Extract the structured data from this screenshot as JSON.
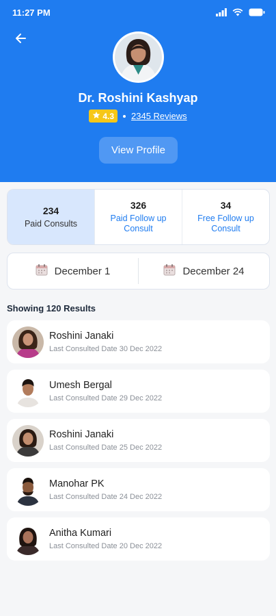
{
  "status_bar": {
    "time": "11:27 PM"
  },
  "doctor": {
    "name": "Dr. Roshini Kashyap",
    "rating": "4.3",
    "reviews": "2345 Reviews",
    "view_profile_label": "View Profile"
  },
  "tabs": [
    {
      "count": "234",
      "label": "Paid Consults",
      "active": true
    },
    {
      "count": "326",
      "label": "Paid Follow up Consult",
      "active": false
    },
    {
      "count": "34",
      "label": "Free Follow up Consult",
      "active": false
    }
  ],
  "date_range": {
    "from": "December 1",
    "to": "December 24"
  },
  "results": {
    "title": "Showing 120 Results",
    "items": [
      {
        "name": "Roshini Janaki",
        "date": "Last Consulted Date 30 Dec 2022"
      },
      {
        "name": "Umesh Bergal",
        "date": "Last Consulted Date 29 Dec 2022"
      },
      {
        "name": "Roshini Janaki",
        "date": "Last Consulted Date 25 Dec 2022"
      },
      {
        "name": "Manohar PK",
        "date": "Last Consulted Date 24 Dec 2022"
      },
      {
        "name": "Anitha Kumari",
        "date": "Last Consulted Date 20 Dec 2022"
      }
    ]
  },
  "colors": {
    "primary": "#1f7cf0",
    "rating_badge": "#f6c718",
    "active_tab_bg": "#d8e7fd",
    "page_bg": "#f5f6f8"
  },
  "icons": {
    "back": "arrow-left-icon",
    "star": "star-icon",
    "calendar": "calendar-icon",
    "signal": "signal-icon",
    "wifi": "wifi-icon",
    "battery": "battery-icon"
  }
}
